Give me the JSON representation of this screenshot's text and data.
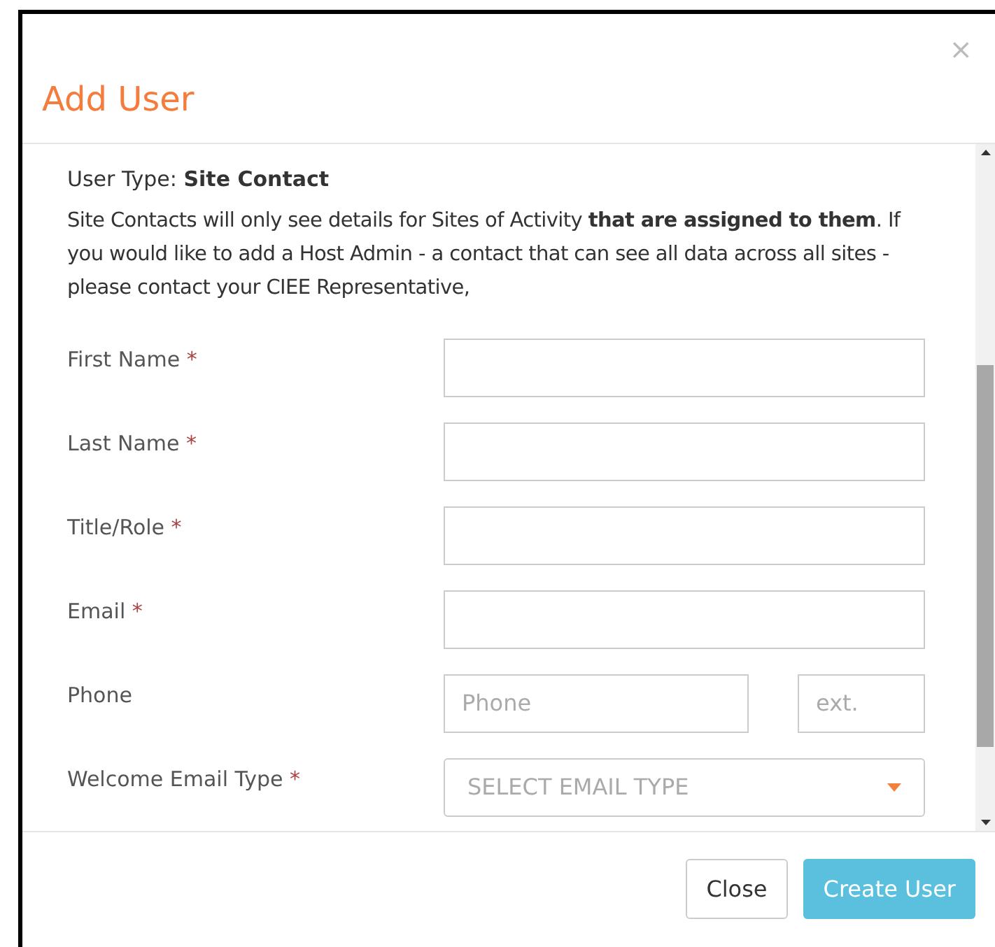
{
  "dialog": {
    "title": "Add User",
    "close_glyph": "×"
  },
  "required_mark": "*",
  "user_type": "User Type: **Site Contact**",
  "description": "Site Contacts will only see details for Sites of Activity **that are assigned to them**. If you would like to add a Host Admin - a contact that can see all data across all sites - please contact your CIEE Representative,",
  "fields": [
    {
      "kind": "text",
      "label": "First Name",
      "required": true
    },
    {
      "kind": "text",
      "label": "Last Name",
      "required": true
    },
    {
      "kind": "text",
      "label": "Title/Role",
      "required": true
    },
    {
      "kind": "text",
      "label": "Email",
      "required": true
    },
    {
      "kind": "phone",
      "label": "Phone",
      "required": false,
      "placeholder": "Phone",
      "ext_placeholder": "ext."
    },
    {
      "kind": "select",
      "label": "Welcome Email Type",
      "required": true,
      "placeholder": "SELECT EMAIL TYPE"
    }
  ],
  "buttons": [
    {
      "label": "Close",
      "kind": "secondary"
    },
    {
      "label": "Create User",
      "kind": "primary"
    }
  ]
}
